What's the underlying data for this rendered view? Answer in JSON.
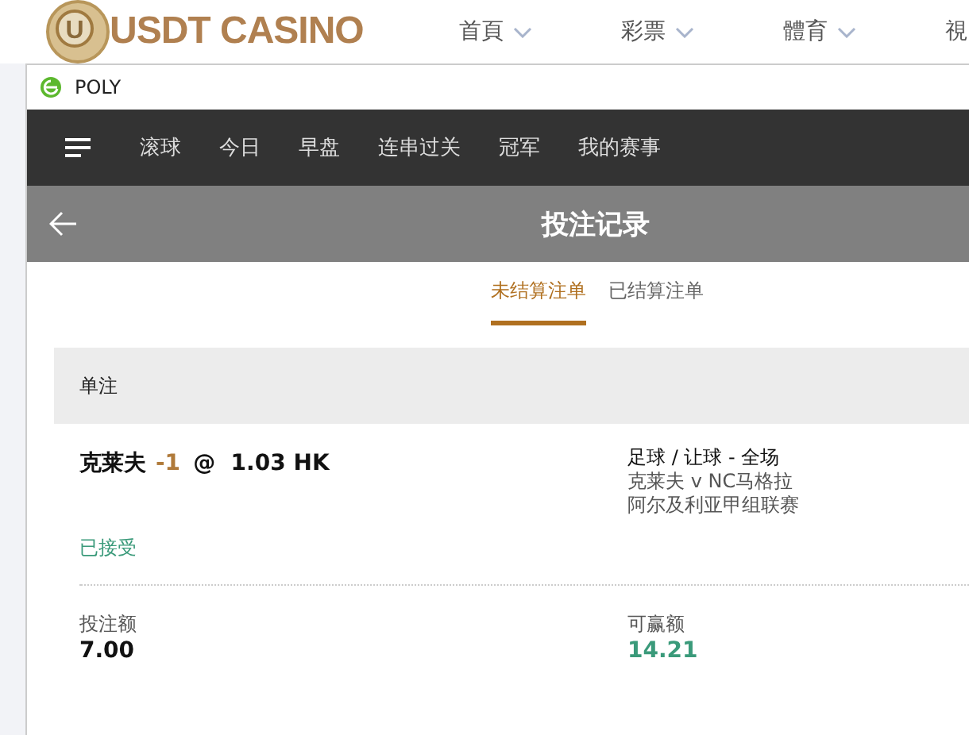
{
  "site": {
    "logo_text": "USDT CASINO",
    "logo_mark": "U",
    "nav": [
      {
        "label": "首頁",
        "dropdown": true
      },
      {
        "label": "彩票",
        "dropdown": true
      },
      {
        "label": "體育",
        "dropdown": true
      },
      {
        "label": "視"
      }
    ]
  },
  "window": {
    "title": "POLY"
  },
  "menu": {
    "items": [
      {
        "label": "滚球"
      },
      {
        "label": "今日"
      },
      {
        "label": "早盘"
      },
      {
        "label": "连串过关"
      },
      {
        "label": "冠军"
      },
      {
        "label": "我的赛事"
      }
    ]
  },
  "header": {
    "title": "投注记录"
  },
  "tabs": [
    {
      "label": "未结算注单",
      "selected": true
    },
    {
      "label": "已结算注单",
      "selected": false
    }
  ],
  "bet": {
    "type": "单注",
    "selection": "克莱夫",
    "handicap": "-1",
    "odds": "@  1.03 HK",
    "market": "足球 / 让球 - 全场",
    "match": "克莱夫 v NC马格拉",
    "league": "阿尔及利亚甲组联赛",
    "status": "已接受",
    "stake_label": "投注额",
    "stake": "7.00",
    "win_label": "可赢额",
    "win": "14.21"
  }
}
